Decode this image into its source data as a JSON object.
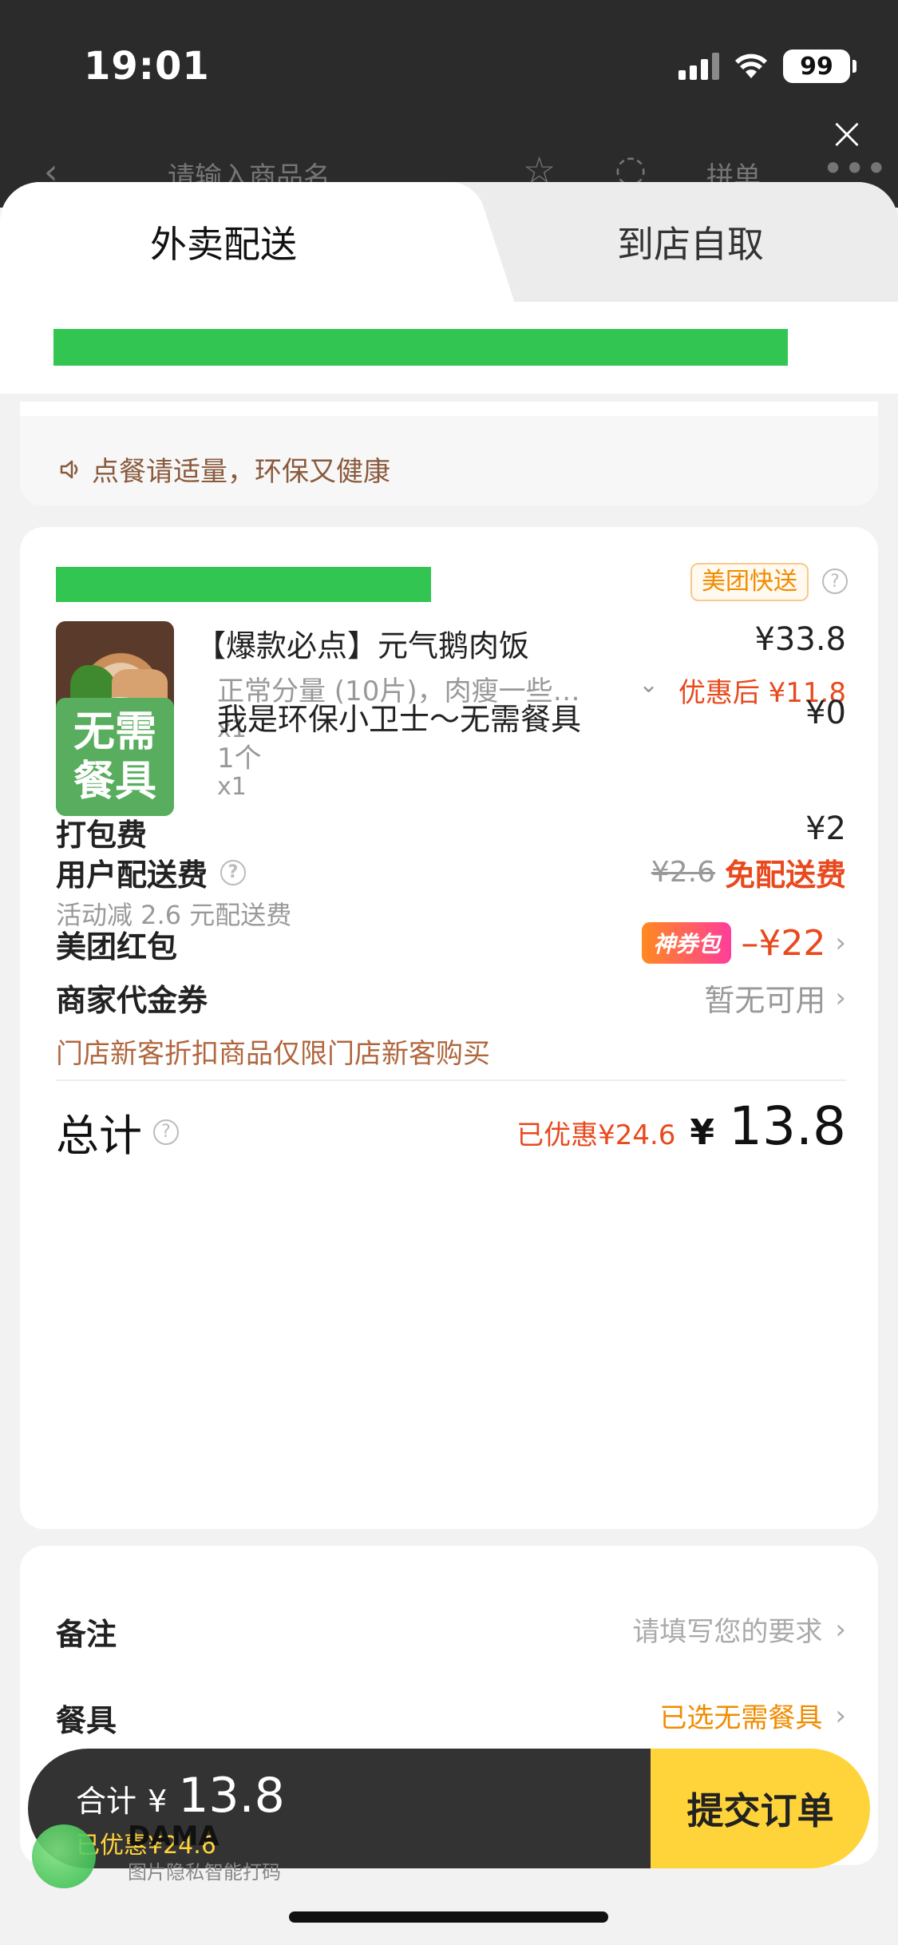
{
  "status_bar": {
    "time": "19:01",
    "battery": "99",
    "icons": [
      "signal-icon",
      "wifi-icon",
      "battery-icon"
    ]
  },
  "behind_header": {
    "search_placeholder": "请输入商品名",
    "pin_label": "拼单"
  },
  "tabs": [
    {
      "label": "外卖配送",
      "active": true
    },
    {
      "label": "到店自取",
      "active": false
    }
  ],
  "notice": {
    "text": "点餐请适量，环保又健康"
  },
  "order": {
    "delivery_badge": "美团快送",
    "items": [
      {
        "name": "【爆款必点】元气鹅肉饭",
        "spec": "正常分量 (10片)，肉瘦一些…",
        "qty": "x1",
        "price": "¥33.8",
        "after_discount": "优惠后 ¥11.8"
      },
      {
        "name": "我是环保小卫士～无需餐具",
        "image_text_1": "无需",
        "image_text_2": "餐具",
        "spec": "1个",
        "qty": "x1",
        "price": "¥0"
      }
    ],
    "packing_fee": {
      "label": "打包费",
      "value": "¥2"
    },
    "delivery_fee": {
      "label": "用户配送费",
      "original": "¥2.6",
      "final": "免配送费",
      "sub": "活动减 2.6 元配送费"
    },
    "red_packet": {
      "label": "美团红包",
      "tag": "神券包",
      "value": "–¥22"
    },
    "merchant_coupon": {
      "label": "商家代金券",
      "value": "暂无可用"
    },
    "new_customer_note": "门店新客折扣商品仅限门店新客购买",
    "total": {
      "label": "总计",
      "discount": "已优惠¥24.6",
      "currency": "¥",
      "amount": "13.8"
    }
  },
  "extras": {
    "remark": {
      "label": "备注",
      "placeholder": "请填写您的要求"
    },
    "tableware": {
      "label": "餐具",
      "value": "已选无需餐具"
    }
  },
  "bottom_bar": {
    "total_label": "合计",
    "currency": "¥",
    "amount": "13.8",
    "discount": "已优惠¥24.6",
    "submit_label": "提交订单"
  },
  "watermark": {
    "title": "DAMA",
    "sub": "图片隐私智能打码"
  },
  "colors": {
    "accent_green": "#33c552",
    "price_red": "#e8491d",
    "submit_yellow": "#ffd43b",
    "dark_bar": "#333333"
  }
}
